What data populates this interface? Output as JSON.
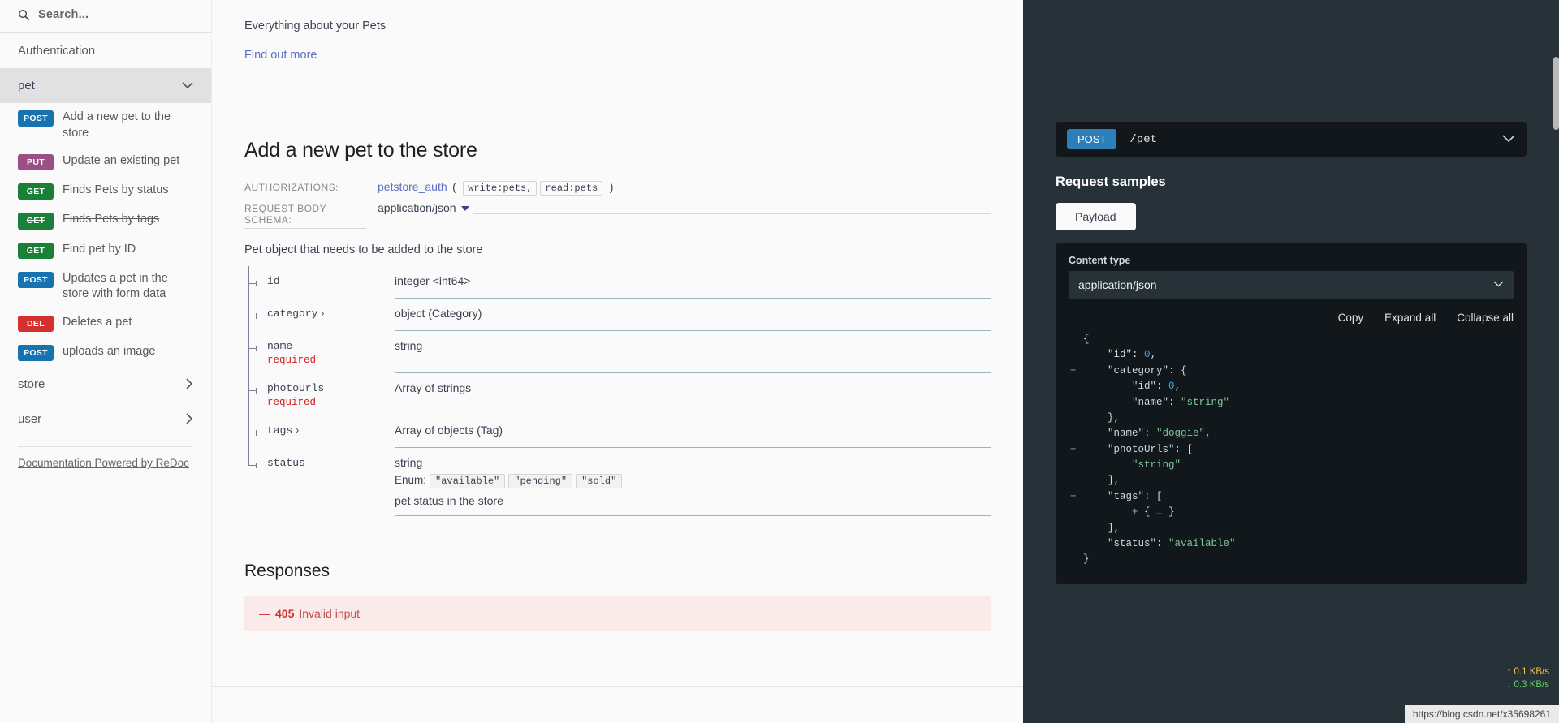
{
  "sidebar": {
    "search": {
      "placeholder": "Search...",
      "value": "",
      "icon": "search-icon"
    },
    "auth_item": "Authentication",
    "active_group": "pet",
    "operations": [
      {
        "verb": "POST",
        "verb_class": "post",
        "label": "Add a new pet to the store",
        "deprecated": false
      },
      {
        "verb": "PUT",
        "verb_class": "put",
        "label": "Update an existing pet",
        "deprecated": false
      },
      {
        "verb": "GET",
        "verb_class": "get",
        "label": "Finds Pets by status",
        "deprecated": false
      },
      {
        "verb": "GET",
        "verb_class": "get",
        "label": "Finds Pets by tags",
        "deprecated": true
      },
      {
        "verb": "GET",
        "verb_class": "get",
        "label": "Find pet by ID",
        "deprecated": false
      },
      {
        "verb": "POST",
        "verb_class": "post",
        "label": "Updates a pet in the store with form data",
        "deprecated": false
      },
      {
        "verb": "DEL",
        "verb_class": "del",
        "label": "Deletes a pet",
        "deprecated": false
      },
      {
        "verb": "POST",
        "verb_class": "post",
        "label": "uploads an image",
        "deprecated": false
      }
    ],
    "groups": [
      {
        "label": "store",
        "chevron": "›"
      },
      {
        "label": "user",
        "chevron": "›"
      }
    ],
    "powered_by": "Documentation Powered by ReDoc"
  },
  "main": {
    "intro_text": "Everything about your Pets",
    "intro_link": "Find out more",
    "operation_title": "Add a new pet to the store",
    "authorizations": {
      "label": "AUTHORIZATIONS:",
      "scheme": "petstore_auth",
      "open_paren": "(",
      "close_paren": ")",
      "scopes": [
        "write:pets,",
        "read:pets"
      ]
    },
    "request_body_schema": {
      "label": "REQUEST BODY SCHEMA:",
      "value": "application/json",
      "caret": "chevron-down-icon"
    },
    "body_description": "Pet object that needs to be added to the store",
    "schema_rows": [
      {
        "name": "id",
        "expandable": false,
        "required": false,
        "type": "integer <int64>",
        "enum": null,
        "description": null
      },
      {
        "name": "category",
        "expandable": true,
        "required": false,
        "type": "object (Category)",
        "enum": null,
        "description": null
      },
      {
        "name": "name",
        "expandable": false,
        "required": true,
        "type": "string",
        "enum": null,
        "description": null
      },
      {
        "name": "photoUrls",
        "expandable": false,
        "required": true,
        "type": "Array of strings",
        "enum": null,
        "description": null
      },
      {
        "name": "tags",
        "expandable": true,
        "required": false,
        "type": "Array of objects (Tag)",
        "enum": null,
        "description": null
      },
      {
        "name": "status",
        "expandable": false,
        "required": false,
        "type": "string",
        "enum_label": "Enum:",
        "enum": [
          "\"available\"",
          "\"pending\"",
          "\"sold\""
        ],
        "description": "pet status in the store"
      }
    ],
    "required_text": "required",
    "expand_glyph": "›",
    "responses_title": "Responses",
    "responses": [
      {
        "dash": "—",
        "code": "405",
        "description": "Invalid input"
      }
    ]
  },
  "right_panel": {
    "endpoint": {
      "verb": "POST",
      "path": "/pet",
      "caret": "chevron-down-icon"
    },
    "request_samples_title": "Request samples",
    "payload_button": "Payload",
    "content_type": {
      "label": "Content type",
      "value": "application/json",
      "caret": "chevron-down-icon"
    },
    "tools": {
      "copy": "Copy",
      "expand_all": "Expand all",
      "collapse_all": "Collapse all"
    },
    "code_lines": [
      {
        "collapser": "",
        "indent": 0,
        "tokens": [
          {
            "t": "punct",
            "v": "{"
          }
        ]
      },
      {
        "collapser": "",
        "indent": 1,
        "tokens": [
          {
            "t": "key",
            "v": "\"id\""
          },
          {
            "t": "punct",
            "v": ": "
          },
          {
            "t": "num",
            "v": "0"
          },
          {
            "t": "punct",
            "v": ","
          }
        ]
      },
      {
        "collapser": "−",
        "indent": 1,
        "tokens": [
          {
            "t": "key",
            "v": "\"category\""
          },
          {
            "t": "punct",
            "v": ": {"
          }
        ]
      },
      {
        "collapser": "",
        "indent": 2,
        "tokens": [
          {
            "t": "key",
            "v": "\"id\""
          },
          {
            "t": "punct",
            "v": ": "
          },
          {
            "t": "num",
            "v": "0"
          },
          {
            "t": "punct",
            "v": ","
          }
        ]
      },
      {
        "collapser": "",
        "indent": 2,
        "tokens": [
          {
            "t": "key",
            "v": "\"name\""
          },
          {
            "t": "punct",
            "v": ": "
          },
          {
            "t": "str",
            "v": "\"string\""
          }
        ]
      },
      {
        "collapser": "",
        "indent": 1,
        "tokens": [
          {
            "t": "punct",
            "v": "},"
          }
        ]
      },
      {
        "collapser": "",
        "indent": 1,
        "tokens": [
          {
            "t": "key",
            "v": "\"name\""
          },
          {
            "t": "punct",
            "v": ": "
          },
          {
            "t": "str",
            "v": "\"doggie\""
          },
          {
            "t": "punct",
            "v": ","
          }
        ]
      },
      {
        "collapser": "−",
        "indent": 1,
        "tokens": [
          {
            "t": "key",
            "v": "\"photoUrls\""
          },
          {
            "t": "punct",
            "v": ": ["
          }
        ]
      },
      {
        "collapser": "",
        "indent": 2,
        "tokens": [
          {
            "t": "str",
            "v": "\"string\""
          }
        ]
      },
      {
        "collapser": "",
        "indent": 1,
        "tokens": [
          {
            "t": "punct",
            "v": "],"
          }
        ]
      },
      {
        "collapser": "−",
        "indent": 1,
        "tokens": [
          {
            "t": "key",
            "v": "\"tags\""
          },
          {
            "t": "punct",
            "v": ": ["
          }
        ]
      },
      {
        "collapser": "",
        "indent": 2,
        "tokens": [
          {
            "t": "plus",
            "v": "+ "
          },
          {
            "t": "punct",
            "v": "{ "
          },
          {
            "t": "ell",
            "v": "…"
          },
          {
            "t": "punct",
            "v": " }"
          }
        ]
      },
      {
        "collapser": "",
        "indent": 1,
        "tokens": [
          {
            "t": "punct",
            "v": "],"
          }
        ]
      },
      {
        "collapser": "",
        "indent": 1,
        "tokens": [
          {
            "t": "key",
            "v": "\"status\""
          },
          {
            "t": "punct",
            "v": ": "
          },
          {
            "t": "str",
            "v": "\"available\""
          }
        ]
      },
      {
        "collapser": "",
        "indent": 0,
        "tokens": [
          {
            "t": "punct",
            "v": "}"
          }
        ]
      }
    ]
  },
  "overlay": {
    "net_up": "↑ 0.1 KB/s",
    "net_down": "↓ 0.3 KB/s",
    "url": "https://blog.csdn.net/x35698261"
  },
  "colors": {
    "post": "#1673b0",
    "put": "#9b4f85",
    "get": "#1a7f37",
    "del": "#d4302f",
    "panel_bg": "#263238",
    "code_bg": "#11171a",
    "link": "#5b6fc4",
    "required": "#d41f1c"
  }
}
